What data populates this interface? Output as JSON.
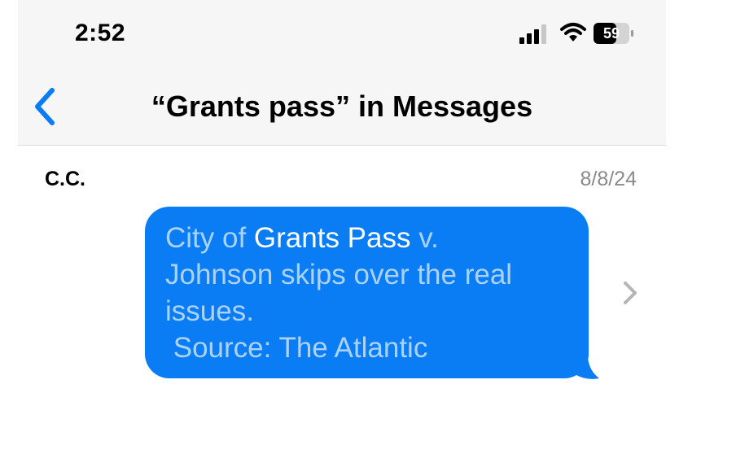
{
  "status_bar": {
    "time": "2:52",
    "battery": "59",
    "icons": [
      "signal-icon",
      "wifi-icon",
      "battery-icon"
    ]
  },
  "nav": {
    "title": "“Grants pass” in Messages",
    "back_icon": "chevron-left-icon"
  },
  "result": {
    "sender": "C.C.",
    "date": "8/8/24",
    "message_pre": "City of ",
    "message_highlight": "Grants Pass",
    "message_post": " v.\nJohnson skips over the real\nissues.\n Source: The Atlantic",
    "open_icon": "chevron-right-icon"
  },
  "colors": {
    "accent": "#0a7cf4",
    "bubble_text": "#aad2fb",
    "highlight_text": "#ffffff",
    "header_bg": "#f6f6f6",
    "secondary_text": "#8a8a8e"
  }
}
